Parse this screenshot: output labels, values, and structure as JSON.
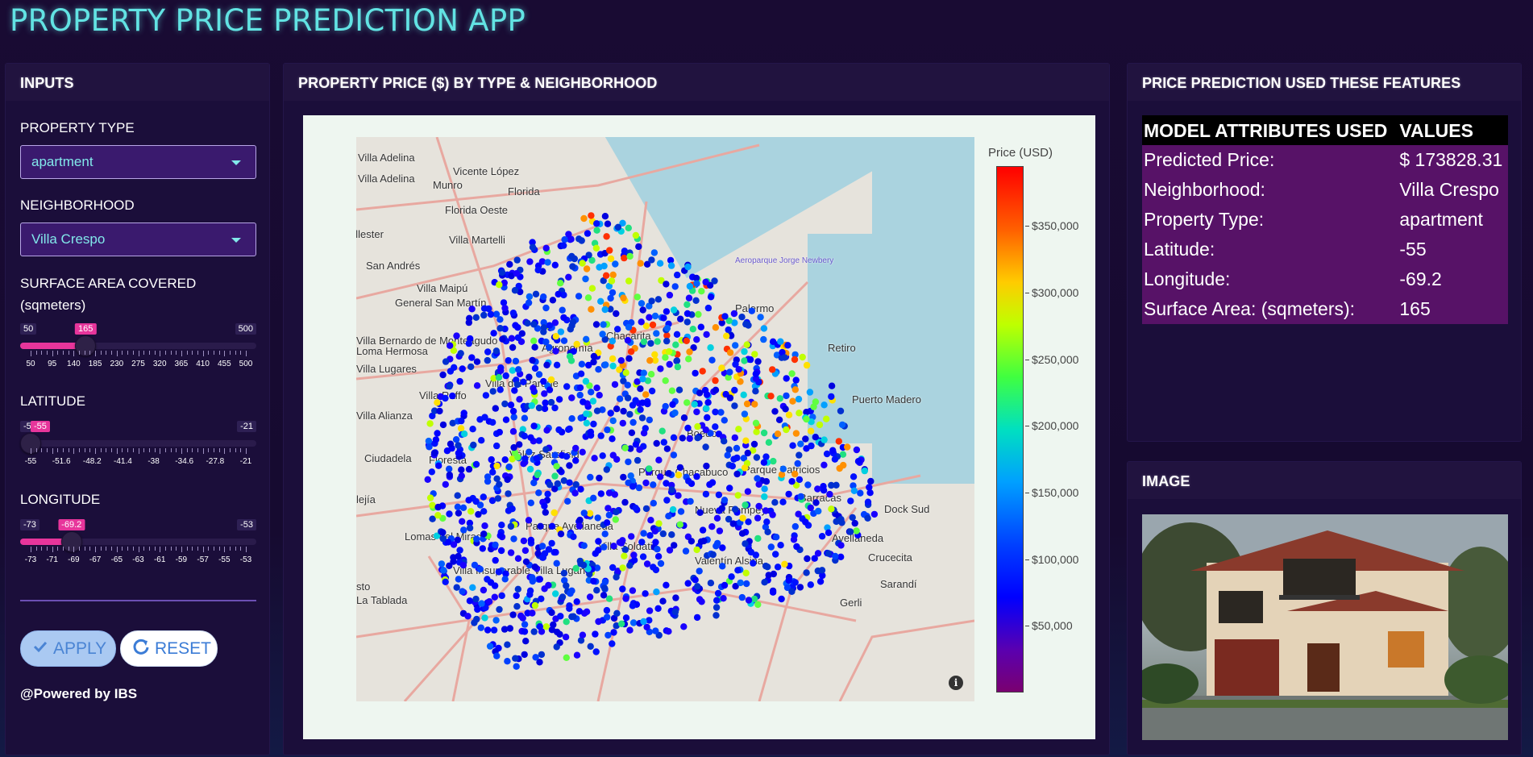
{
  "app": {
    "title": "PROPERTY PRICE PREDICTION APP"
  },
  "inputs": {
    "header": "INPUTS",
    "property_type": {
      "label": "PROPERTY TYPE",
      "value": "apartment"
    },
    "neighborhood": {
      "label": "NEIGHBORHOOD",
      "value": "Villa Crespo"
    },
    "surface": {
      "label_line1": "SURFACE AREA COVERED",
      "label_line2": "(sqmeters)",
      "min": "50",
      "max": "500",
      "value": "165",
      "fill_fraction": 0.2556,
      "ticks": [
        "50",
        "95",
        "140",
        "185",
        "230",
        "275",
        "320",
        "365",
        "410",
        "455",
        "500"
      ]
    },
    "latitude": {
      "label": "LATITUDE",
      "min": "-55",
      "max": "-21",
      "value": "-55",
      "fill_fraction": 0.0,
      "ticks": [
        "-55",
        "-51.6",
        "-48.2",
        "-41.4",
        "-38",
        "-34.6",
        "-27.8",
        "-21"
      ]
    },
    "longitude": {
      "label": "LONGITUDE",
      "min": "-73",
      "max": "-53",
      "value": "-69.2",
      "fill_fraction": 0.19,
      "ticks": [
        "-73",
        "-71",
        "-69",
        "-67",
        "-65",
        "-63",
        "-61",
        "-59",
        "-57",
        "-55",
        "-53"
      ]
    },
    "apply_label": "APPLY",
    "reset_label": "RESET",
    "powered_by": "@Powered by IBS"
  },
  "map_card": {
    "header": "PROPERTY PRICE ($) BY TYPE & NEIGHBORHOOD",
    "colorbar_title": "Price (USD)",
    "colorbar_ticks": [
      "$350,000",
      "$300,000",
      "$250,000",
      "$200,000",
      "$150,000",
      "$100,000",
      "$50,000"
    ],
    "places": [
      "Villa Adelina",
      "Villa Adelina",
      "Vicente López",
      "Munro",
      "Florida",
      "Florida Oeste",
      "allester",
      "Villa Martelli",
      "San Andrés",
      "Villa Maipú",
      "General San Martín",
      "Villa Bernardo de Monteagudo",
      "Loma Hermosa",
      "Villa Lugares",
      "Villa Raffo",
      "Villa Alianza",
      "Ciudadela",
      "Lomas del Mirador",
      "Villa Insuperable",
      "Villa Lugano",
      "La Tablada",
      "Villa Soldati",
      "Parque Avellaneda",
      "Nueva Pompeya",
      "Valentín Alsina",
      "Avellaneda",
      "Crucecita",
      "Sarandí",
      "Dock Sud",
      "Barracas",
      "Puerto Madero",
      "Retiro",
      "Aeroparque Jorge Newbery",
      "Chacarita",
      "Agronomía",
      "Villa del Parque",
      "Floresta",
      "Vélez Sarsfield",
      "Parque Chacabuco",
      "Parque Patricios",
      "Boedo",
      "Palermo",
      "Gerli",
      "lejía",
      "sto"
    ]
  },
  "prediction": {
    "header": "PRICE PREDICTION USED THESE FEATURES",
    "columns": [
      "MODEL ATTRIBUTES USED",
      "VALUES"
    ],
    "rows": [
      [
        "Predicted Price:",
        "$ 173828.31"
      ],
      [
        "Neighborhood:",
        "Villa Crespo"
      ],
      [
        "Property Type:",
        "apartment"
      ],
      [
        "Latitude:",
        "-55"
      ],
      [
        "Longitude:",
        "-69.2"
      ],
      [
        "Surface Area: (sqmeters):",
        "165"
      ]
    ]
  },
  "image_card": {
    "header": "IMAGE"
  },
  "colors": {
    "accent": "#e7359b",
    "title": "#62e3e3",
    "table_row": "#571267",
    "card": "#1b0e3a"
  },
  "icons": {
    "apply": "check-icon",
    "reset": "refresh-icon",
    "dropdown": "caret-down-icon",
    "map_info": "info-icon"
  }
}
